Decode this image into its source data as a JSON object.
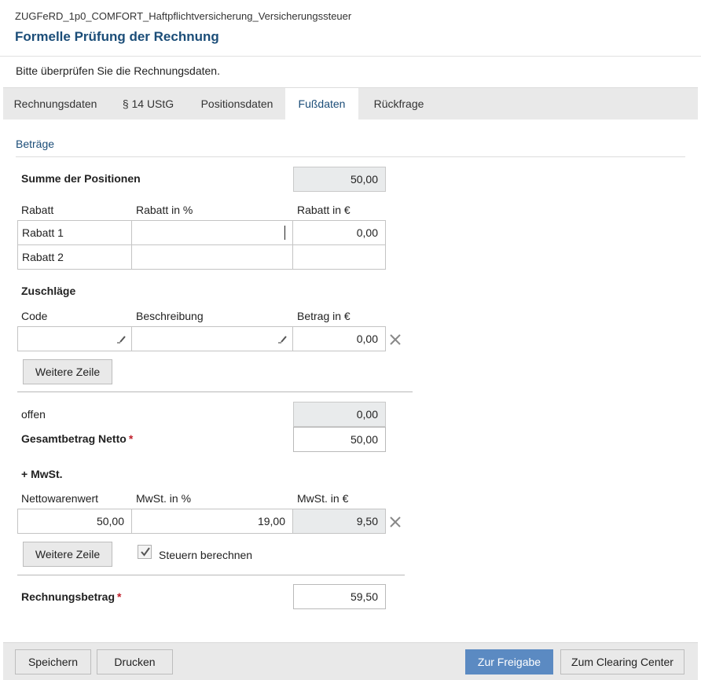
{
  "header": {
    "document_name": "ZUGFeRD_1p0_COMFORT_Haftpflichtversicherung_Versicherungssteuer",
    "title": "Formelle Prüfung der Rechnung",
    "intro": "Bitte überprüfen Sie die Rechnungsdaten."
  },
  "tabs": [
    {
      "label": "Rechnungsdaten"
    },
    {
      "label": "§ 14 UStG"
    },
    {
      "label": "Positionsdaten"
    },
    {
      "label": "Fußdaten",
      "active": true
    },
    {
      "label": "Rückfrage"
    }
  ],
  "betraege": {
    "section_title": "Beträge",
    "summe_label": "Summe der Positionen",
    "summe_value": "50,00"
  },
  "rabatt": {
    "headers": [
      "Rabatt",
      "Rabatt in %",
      "Rabatt in €"
    ],
    "rows": [
      {
        "name": "Rabatt 1",
        "percent": "",
        "amount": "0,00"
      },
      {
        "name": "Rabatt 2",
        "percent": "",
        "amount": ""
      }
    ]
  },
  "zuschlaege": {
    "title": "Zuschläge",
    "headers": [
      "Code",
      "Beschreibung",
      "Betrag in €"
    ],
    "rows": [
      {
        "code": "",
        "description": "",
        "amount": "0,00"
      }
    ],
    "add_row_label": "Weitere Zeile"
  },
  "totals": {
    "offen_label": "offen",
    "offen_value": "0,00",
    "netto_label": "Gesamtbetrag Netto",
    "netto_value": "50,00",
    "required_mark": "*"
  },
  "mwst": {
    "title": "+ MwSt.",
    "headers": [
      "Nettowarenwert",
      "MwSt. in %",
      "MwSt. in €"
    ],
    "rows": [
      {
        "net": "50,00",
        "percent": "19,00",
        "amount": "9,50"
      }
    ],
    "add_row_label": "Weitere Zeile",
    "calc_label": "Steuern berechnen",
    "calc_checked": true
  },
  "rechnungsbetrag": {
    "label": "Rechnungsbetrag",
    "value": "59,50"
  },
  "footer": {
    "save_label": "Speichern",
    "print_label": "Drucken",
    "release_label": "Zur Freigabe",
    "clearing_label": "Zum Clearing Center"
  },
  "colors": {
    "title": "#1b4d78",
    "primary_button": "#5b8ac2",
    "required": "#c0202c",
    "readonly_field": "#e9ebec"
  }
}
